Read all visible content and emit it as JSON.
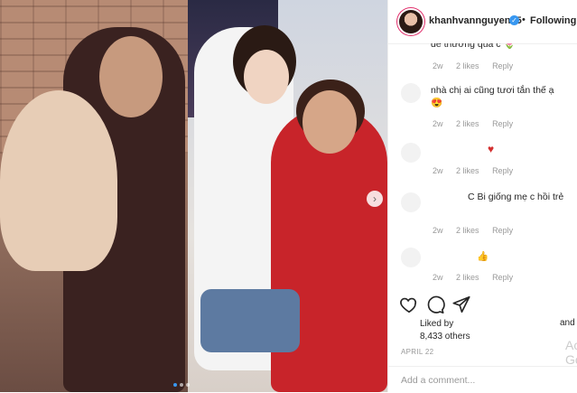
{
  "post": {
    "username": "khanhvannguyen25",
    "follow_separator": "•",
    "follow_label": "Following",
    "verified_mark": "✓"
  },
  "comments": [
    {
      "text": "dễ thương quá c 🌷",
      "age": "2w",
      "likes": "2 likes",
      "reply": "Reply"
    },
    {
      "text": "nhà chị ai cũng tươi tắn thế ạ 😍",
      "age": "2w",
      "likes": "2 likes",
      "reply": "Reply"
    },
    {
      "text": "♥",
      "age": "2w",
      "likes": "2 likes",
      "reply": "Reply"
    },
    {
      "text": "C Bi giống mẹ c hồi trẻ",
      "age": "2w",
      "likes": "2 likes",
      "reply": "Reply"
    },
    {
      "text": "👍",
      "age": "2w",
      "likes": "2 likes",
      "reply": "Reply"
    }
  ],
  "likes": {
    "prefix": "Liked by",
    "count": "8,433 others",
    "and": "and"
  },
  "date": "APRIL 22",
  "add_comment_placeholder": "Add a comment...",
  "watermark": "Ac\nGo",
  "icons": [
    "heart-icon",
    "comment-icon",
    "share-icon",
    "next-arrow-icon",
    "verified-icon"
  ],
  "colors": {
    "accent": "#3897f0",
    "text": "#262626",
    "muted": "#999999"
  }
}
